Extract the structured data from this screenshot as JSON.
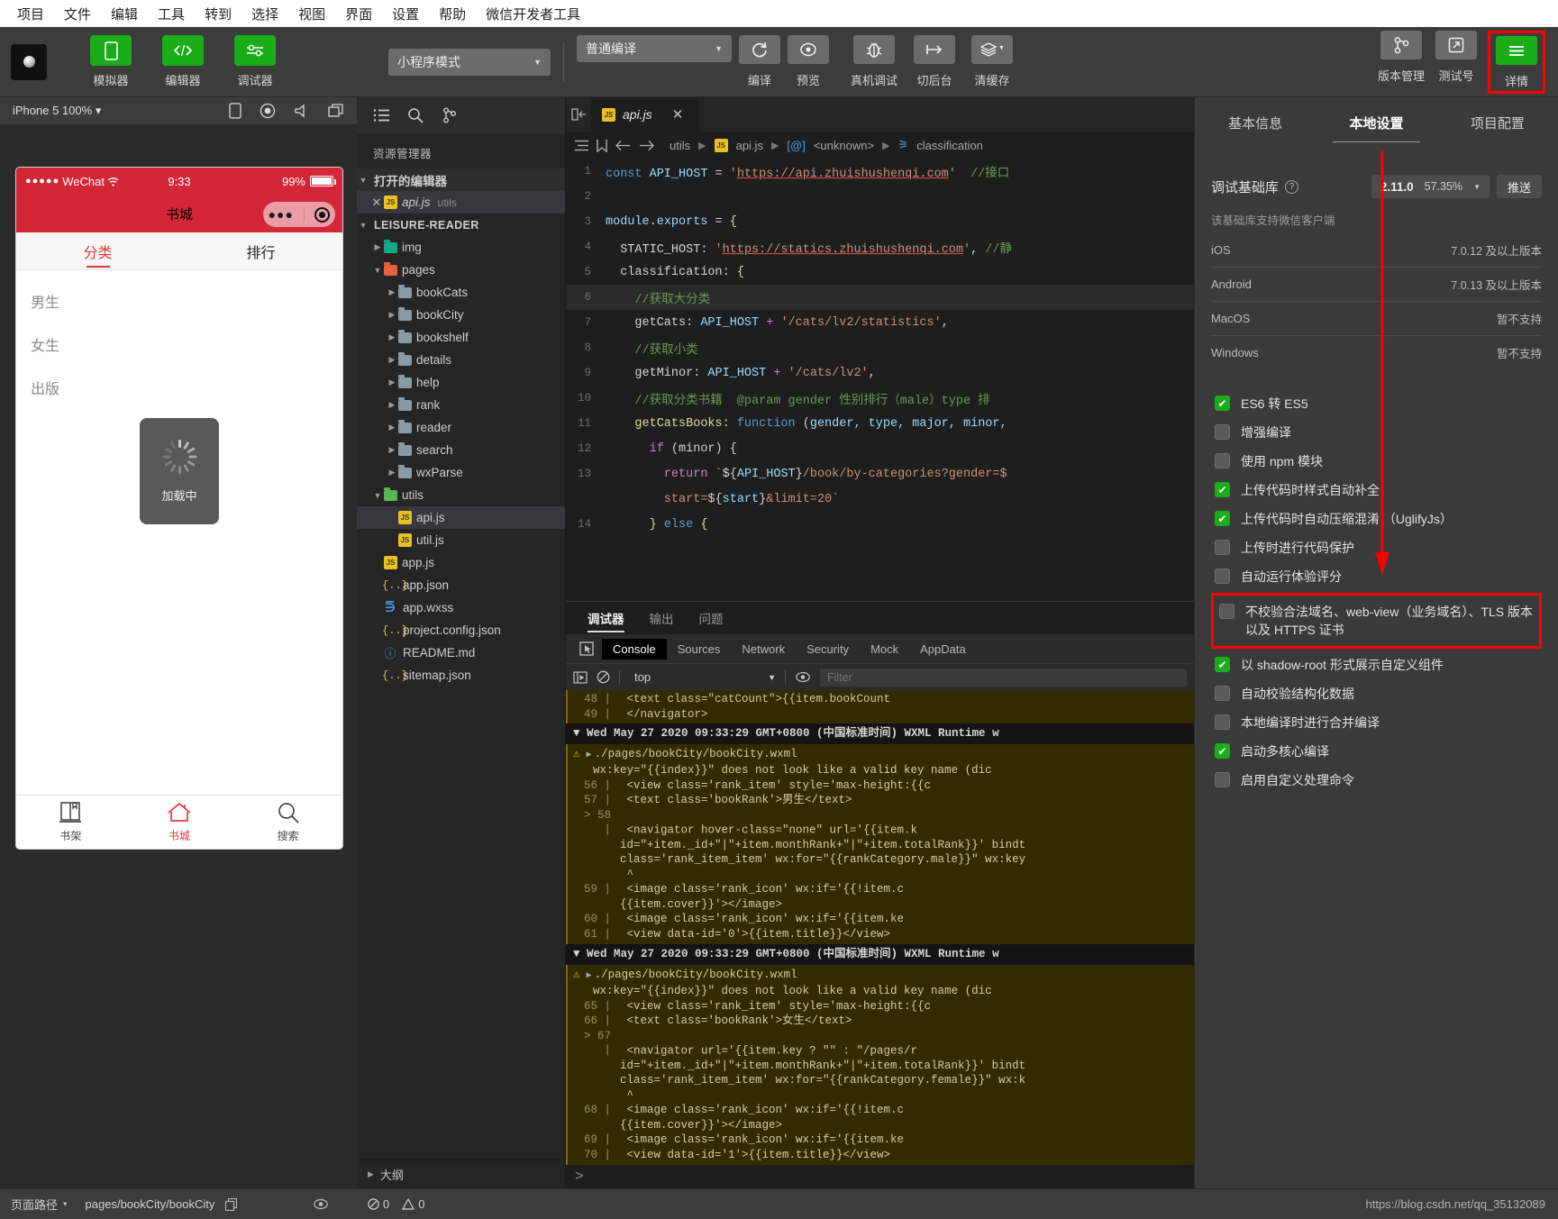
{
  "menubar": {
    "items": [
      "项目",
      "文件",
      "编辑",
      "工具",
      "转到",
      "选择",
      "视图",
      "界面",
      "设置",
      "帮助",
      "微信开发者工具"
    ]
  },
  "toolbar": {
    "panel_buttons": [
      {
        "label": "模拟器",
        "icon": "phone-icon"
      },
      {
        "label": "编辑器",
        "icon": "code-icon"
      },
      {
        "label": "调试器",
        "icon": "sliders-icon"
      }
    ],
    "mode_select": "小程序模式",
    "compile_select": "普通编译",
    "actions": [
      {
        "label": "编译",
        "icon": "refresh-icon"
      },
      {
        "label": "预览",
        "icon": "eye-icon"
      },
      {
        "label": "真机调试",
        "icon": "bug-icon"
      },
      {
        "label": "切后台",
        "icon": "background-icon"
      },
      {
        "label": "清缓存",
        "icon": "layers-icon"
      }
    ],
    "right_actions": [
      {
        "label": "版本管理",
        "icon": "branch-icon"
      },
      {
        "label": "测试号",
        "icon": "external-link-icon"
      },
      {
        "label": "详情",
        "icon": "menu-icon"
      }
    ]
  },
  "simulator": {
    "device": "iPhone 5 100%",
    "header_icons": [
      "rotate-icon",
      "record-icon",
      "volume-icon",
      "window-icon"
    ],
    "status_bar": {
      "carrier": "WeChat",
      "dots": "●●●●●",
      "time": "9:33",
      "battery": "99%"
    },
    "nav_title": "书城",
    "tabs": [
      {
        "label": "分类",
        "active": true
      },
      {
        "label": "排行",
        "active": false
      }
    ],
    "categories": [
      "男生",
      "女生",
      "出版"
    ],
    "loading_text": "加载中",
    "tabbar": [
      {
        "label": "书架",
        "icon": "bookshelf-icon",
        "selected": false
      },
      {
        "label": "书城",
        "icon": "home-icon",
        "selected": true
      },
      {
        "label": "搜索",
        "icon": "search-icon",
        "selected": false
      }
    ]
  },
  "explorer": {
    "header_icons": [
      "list-icon",
      "search-icon",
      "source-control-icon"
    ],
    "title": "资源管理器",
    "open_editors_label": "打开的编辑器",
    "open_editors": [
      {
        "name": "api.js",
        "folder": "utils"
      }
    ],
    "project_name": "LEISURE-READER",
    "tree": [
      {
        "name": "img",
        "type": "folder",
        "icon": "folder-img-icon",
        "depth": 1,
        "expanded": false
      },
      {
        "name": "pages",
        "type": "folder",
        "icon": "folder-pages-icon",
        "depth": 1,
        "expanded": true
      },
      {
        "name": "bookCats",
        "type": "folder",
        "icon": "folder-icon",
        "depth": 2,
        "expanded": false
      },
      {
        "name": "bookCity",
        "type": "folder",
        "icon": "folder-icon",
        "depth": 2,
        "expanded": false
      },
      {
        "name": "bookshelf",
        "type": "folder",
        "icon": "folder-icon",
        "depth": 2,
        "expanded": false
      },
      {
        "name": "details",
        "type": "folder",
        "icon": "folder-icon",
        "depth": 2,
        "expanded": false
      },
      {
        "name": "help",
        "type": "folder",
        "icon": "folder-icon",
        "depth": 2,
        "expanded": false
      },
      {
        "name": "rank",
        "type": "folder",
        "icon": "folder-icon",
        "depth": 2,
        "expanded": false
      },
      {
        "name": "reader",
        "type": "folder",
        "icon": "folder-icon",
        "depth": 2,
        "expanded": false
      },
      {
        "name": "search",
        "type": "folder",
        "icon": "folder-icon",
        "depth": 2,
        "expanded": false
      },
      {
        "name": "wxParse",
        "type": "folder",
        "icon": "folder-icon",
        "depth": 2,
        "expanded": false
      },
      {
        "name": "utils",
        "type": "folder",
        "icon": "folder-utils-icon",
        "depth": 1,
        "expanded": true
      },
      {
        "name": "api.js",
        "type": "js",
        "icon": "js-icon",
        "depth": 2,
        "selected": true
      },
      {
        "name": "util.js",
        "type": "js",
        "icon": "js-icon",
        "depth": 2
      },
      {
        "name": "app.js",
        "type": "js",
        "icon": "js-icon",
        "depth": 1
      },
      {
        "name": "app.json",
        "type": "json",
        "icon": "json-icon",
        "depth": 1
      },
      {
        "name": "app.wxss",
        "type": "css",
        "icon": "css-icon",
        "depth": 1
      },
      {
        "name": "project.config.json",
        "type": "json",
        "icon": "json-icon",
        "depth": 1
      },
      {
        "name": "README.md",
        "type": "md",
        "icon": "info-icon",
        "depth": 1
      },
      {
        "name": "sitemap.json",
        "type": "json",
        "icon": "json-icon",
        "depth": 1
      }
    ],
    "outline_label": "大纲"
  },
  "editor": {
    "tab": {
      "name": "api.js",
      "icon": "js-icon"
    },
    "breadcrumb": [
      "utils",
      "api.js",
      "<unknown>",
      "classification"
    ],
    "lines": [
      {
        "n": 1,
        "tokens": [
          {
            "t": "const ",
            "c": "k-kw2"
          },
          {
            "t": "API_HOST ",
            "c": "k-var"
          },
          {
            "t": "= ",
            "c": "k-op"
          },
          {
            "t": "'",
            "c": "k-str"
          },
          {
            "t": "https://api.zhuishushenqi.com",
            "c": "k-link"
          },
          {
            "t": "'",
            "c": "k-str"
          },
          {
            "t": "  //接口",
            "c": "k-com"
          }
        ]
      },
      {
        "n": 2,
        "tokens": []
      },
      {
        "n": 3,
        "tokens": [
          {
            "t": "module",
            "c": "k-var"
          },
          {
            "t": ".",
            "c": "k-op"
          },
          {
            "t": "exports ",
            "c": "k-var"
          },
          {
            "t": "= ",
            "c": "k-op"
          },
          {
            "t": "{",
            "c": "k-fn"
          }
        ]
      },
      {
        "n": 4,
        "tokens": [
          {
            "t": "  STATIC_HOST: ",
            "c": "k-pl"
          },
          {
            "t": "'",
            "c": "k-str"
          },
          {
            "t": "https://statics.zhuishushenqi.com",
            "c": "k-link"
          },
          {
            "t": "'",
            "c": "k-str"
          },
          {
            "t": ", ",
            "c": "k-op"
          },
          {
            "t": "//静",
            "c": "k-com"
          }
        ]
      },
      {
        "n": 5,
        "tokens": [
          {
            "t": "  classification: ",
            "c": "k-pl"
          },
          {
            "t": "{",
            "c": "k-fn"
          }
        ]
      },
      {
        "n": 6,
        "hl": true,
        "tokens": [
          {
            "t": "    //获取大分类",
            "c": "k-com"
          }
        ]
      },
      {
        "n": 7,
        "tokens": [
          {
            "t": "    getCats: ",
            "c": "k-pl"
          },
          {
            "t": "API_HOST ",
            "c": "k-var"
          },
          {
            "t": "+ ",
            "c": "k-kw"
          },
          {
            "t": "'/cats/lv2/statistics'",
            "c": "k-str"
          },
          {
            "t": ",",
            "c": "k-op"
          }
        ]
      },
      {
        "n": 8,
        "tokens": [
          {
            "t": "    //获取小类",
            "c": "k-com"
          }
        ]
      },
      {
        "n": 9,
        "tokens": [
          {
            "t": "    getMinor: ",
            "c": "k-pl"
          },
          {
            "t": "API_HOST ",
            "c": "k-var"
          },
          {
            "t": "+ ",
            "c": "k-kw"
          },
          {
            "t": "'/cats/lv2'",
            "c": "k-str"
          },
          {
            "t": ",",
            "c": "k-op"
          }
        ]
      },
      {
        "n": 10,
        "tokens": [
          {
            "t": "    //获取分类书籍  @param gender 性别排行（male）type 排",
            "c": "k-com"
          }
        ]
      },
      {
        "n": 11,
        "tokens": [
          {
            "t": "    getCatsBooks: ",
            "c": "k-fn"
          },
          {
            "t": "function ",
            "c": "k-kw2"
          },
          {
            "t": "(",
            "c": "k-op"
          },
          {
            "t": "gender, type, major, minor,",
            "c": "k-var"
          }
        ]
      },
      {
        "n": 12,
        "tokens": [
          {
            "t": "      if ",
            "c": "k-kw"
          },
          {
            "t": "(minor) {",
            "c": "k-op"
          }
        ]
      },
      {
        "n": 13,
        "tokens": [
          {
            "t": "        return ",
            "c": "k-kw"
          },
          {
            "t": "`",
            "c": "k-str"
          },
          {
            "t": "${",
            "c": "k-op"
          },
          {
            "t": "API_HOST",
            "c": "k-var"
          },
          {
            "t": "}",
            "c": "k-op"
          },
          {
            "t": "/book/by-categories?gender=$",
            "c": "k-str"
          }
        ]
      },
      {
        "n": null,
        "tokens": [
          {
            "t": "        start=",
            "c": "k-str"
          },
          {
            "t": "${",
            "c": "k-op"
          },
          {
            "t": "start",
            "c": "k-var"
          },
          {
            "t": "}",
            "c": "k-op"
          },
          {
            "t": "&limit=20`",
            "c": "k-str"
          }
        ]
      },
      {
        "n": 14,
        "tokens": [
          {
            "t": "      } ",
            "c": "k-fn"
          },
          {
            "t": "else ",
            "c": "k-kw2"
          },
          {
            "t": "{",
            "c": "k-fn"
          }
        ]
      }
    ]
  },
  "console": {
    "panel_tabs": [
      {
        "label": "调试器",
        "active": true
      },
      {
        "label": "输出",
        "active": false
      },
      {
        "label": "问题",
        "active": false
      }
    ],
    "devtool_tabs": [
      {
        "label": "Console",
        "active": true
      },
      {
        "label": "Sources",
        "active": false
      },
      {
        "label": "Network",
        "active": false
      },
      {
        "label": "Security",
        "active": false
      },
      {
        "label": "Mock",
        "active": false
      },
      {
        "label": "AppData",
        "active": false
      }
    ],
    "context": "top",
    "filter_placeholder": "Filter",
    "entries": [
      {
        "type": "source",
        "lines": [
          {
            "n": "48",
            "text": "              <text class=\"catCount\">{{item.bookCount"
          },
          {
            "n": "49",
            "text": "            </navigator>"
          }
        ]
      },
      {
        "type": "timestamp",
        "text": "Wed May 27 2020 09:33:29 GMT+0800 (中国标准时间) WXML Runtime w"
      },
      {
        "type": "warning",
        "file": "./pages/bookCity/bookCity.wxml",
        "message": "wx:key=\"{{index}}\" does not look like a valid key name (dic",
        "lines": [
          {
            "n": "56",
            "text": "          <view class='rank_item' style='max-height:{{c"
          },
          {
            "n": "57",
            "text": "            <text class='bookRank'>男生</text>"
          },
          {
            "n": "> 58",
            "text": "            <navigator hover-class=\"none\" url='{{item.k"
          },
          {
            "n": "",
            "text": "id=\"+item._id+\"|\"+item.monthRank+\"|\"+item.totalRank}}' bindt"
          },
          {
            "n": "",
            "text": "class='rank_item_item' wx:for=\"{{rankCategory.male}}\" wx:key"
          },
          {
            "n": "",
            "text": "                    ^"
          },
          {
            "n": "59",
            "text": "              <image class='rank_icon' wx:if='{{!item.c"
          },
          {
            "n": "",
            "text": "{{item.cover}}'></image>"
          },
          {
            "n": "60",
            "text": "              <image class='rank_icon' wx:if='{{item.ke"
          },
          {
            "n": "61",
            "text": "              <view data-id='0'>{{item.title}}</view>"
          }
        ]
      },
      {
        "type": "timestamp",
        "text": "Wed May 27 2020 09:33:29 GMT+0800 (中国标准时间) WXML Runtime w"
      },
      {
        "type": "warning",
        "file": "./pages/bookCity/bookCity.wxml",
        "message": "wx:key=\"{{index}}\" does not look like a valid key name (dic",
        "lines": [
          {
            "n": "65",
            "text": "          <view class='rank_item' style='max-height:{{c"
          },
          {
            "n": "66",
            "text": "            <text class='bookRank'>女生</text>"
          },
          {
            "n": "> 67",
            "text": "            <navigator url='{{item.key ? \"\" : \"/pages/r"
          },
          {
            "n": "",
            "text": "id=\"+item._id+\"|\"+item.monthRank+\"|\"+item.totalRank}}' bindt"
          },
          {
            "n": "",
            "text": "class='rank_item_item' wx:for=\"{{rankCategory.female}}\" wx:k"
          },
          {
            "n": "",
            "text": "                    ^"
          },
          {
            "n": "68",
            "text": "              <image class='rank_icon' wx:if='{{!item.c"
          },
          {
            "n": "",
            "text": "{{item.cover}}'></image>"
          },
          {
            "n": "69",
            "text": "              <image class='rank_icon' wx:if='{{item.ke"
          },
          {
            "n": "70",
            "text": "              <view data-id='1'>{{item.title}}</view>"
          }
        ]
      }
    ],
    "prompt": ">"
  },
  "settings": {
    "tabs": [
      {
        "label": "基本信息",
        "active": false
      },
      {
        "label": "本地设置",
        "active": true
      },
      {
        "label": "项目配置",
        "active": false
      }
    ],
    "debug_lib": {
      "label": "调试基础库",
      "version": "2.11.0",
      "percent": "57.35%",
      "push_label": "推送"
    },
    "support_note": "该基础库支持微信客户端",
    "support_rows": [
      {
        "os": "iOS",
        "value": "7.0.12 及以上版本"
      },
      {
        "os": "Android",
        "value": "7.0.13 及以上版本"
      },
      {
        "os": "MacOS",
        "value": "暂不支持"
      },
      {
        "os": "Windows",
        "value": "暂不支持"
      }
    ],
    "checkboxes": [
      {
        "label": "ES6 转 ES5",
        "checked": true,
        "highlight": false
      },
      {
        "label": "增强编译",
        "checked": false,
        "highlight": false
      },
      {
        "label": "使用 npm 模块",
        "checked": false,
        "highlight": false
      },
      {
        "label": "上传代码时样式自动补全",
        "checked": true,
        "highlight": false
      },
      {
        "label": "上传代码时自动压缩混淆 （UglifyJs）",
        "checked": true,
        "highlight": false
      },
      {
        "label": "上传时进行代码保护",
        "checked": false,
        "highlight": false
      },
      {
        "label": "自动运行体验评分",
        "checked": false,
        "highlight": false
      },
      {
        "label": "不校验合法域名、web-view（业务域名）、TLS 版本以及 HTTPS 证书",
        "checked": false,
        "highlight": true
      },
      {
        "label": "以 shadow-root 形式展示自定义组件",
        "checked": true,
        "highlight": false
      },
      {
        "label": "自动校验结构化数据",
        "checked": false,
        "highlight": false
      },
      {
        "label": "本地编译时进行合并编译",
        "checked": false,
        "highlight": false
      },
      {
        "label": "启动多核心编译",
        "checked": true,
        "highlight": false
      },
      {
        "label": "启用自定义处理命令",
        "checked": false,
        "highlight": false
      }
    ]
  },
  "statusbar": {
    "page_path_label": "页面路径",
    "page_path": "pages/bookCity/bookCity",
    "errors": "0",
    "warnings": "0",
    "watermark": "https://blog.csdn.net/qq_35132089"
  },
  "colors": {
    "accent_green": "#1aad19",
    "highlight_red": "#ff0000",
    "phone_nav_red": "#d32638",
    "toolbar_bg": "#3c3c3c",
    "editor_bg": "#1e1e1e"
  }
}
